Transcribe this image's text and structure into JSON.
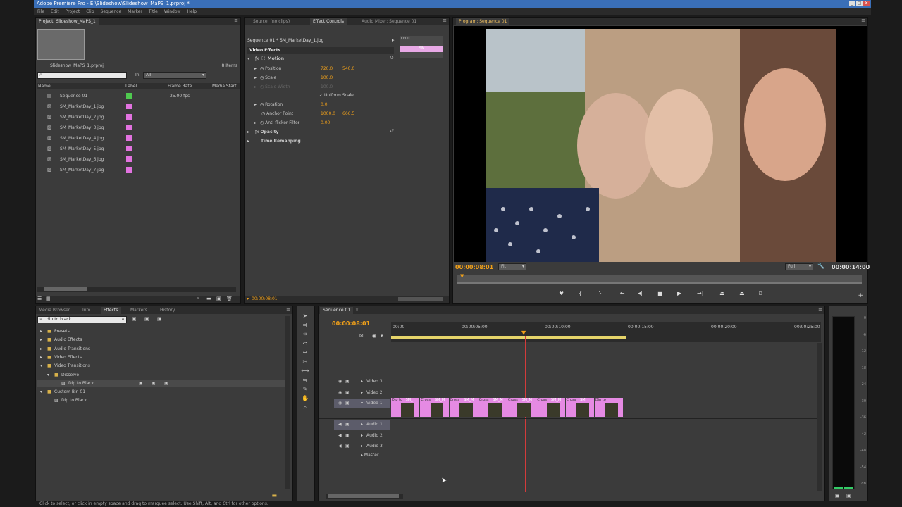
{
  "app": {
    "title": "Adobe Premiere Pro - E:\\Slideshow\\Slideshow_MaPS_1.prproj *",
    "menus": [
      "File",
      "Edit",
      "Project",
      "Clip",
      "Sequence",
      "Marker",
      "Title",
      "Window",
      "Help"
    ]
  },
  "project_panel": {
    "tab": "Project: Slideshow_MaPS_1",
    "project_file": "Slideshow_MaPS_1.prproj",
    "item_count": "8 Items",
    "in_label": "In:",
    "in_value": "All",
    "columns": [
      "Name",
      "Label",
      "Frame Rate",
      "Media Start"
    ],
    "items": [
      {
        "name": "Sequence 01",
        "frame_rate": "25.00 fps",
        "label_color": "#4fc94f"
      },
      {
        "name": "SM_MarketDay_1.jpg",
        "frame_rate": "",
        "label_color": "#e273e0"
      },
      {
        "name": "SM_MarketDay_2.jpg",
        "frame_rate": "",
        "label_color": "#e273e0"
      },
      {
        "name": "SM_MarketDay_3.jpg",
        "frame_rate": "",
        "label_color": "#e273e0"
      },
      {
        "name": "SM_MarketDay_4.jpg",
        "frame_rate": "",
        "label_color": "#e273e0"
      },
      {
        "name": "SM_MarketDay_5.jpg",
        "frame_rate": "",
        "label_color": "#e273e0"
      },
      {
        "name": "SM_MarketDay_6.jpg",
        "frame_rate": "",
        "label_color": "#e273e0"
      },
      {
        "name": "SM_MarketDay_7.jpg",
        "frame_rate": "",
        "label_color": "#e273e0"
      }
    ]
  },
  "effect_controls": {
    "tabs": [
      "Source: (no clips)",
      "Effect Controls",
      "Audio Mixer: Sequence 01"
    ],
    "clip_path": "Sequence 01 * SM_MarketDay_1.jpg",
    "time_start": "00:00",
    "clip_mini": "SM",
    "section": "Video Effects",
    "motion": "Motion",
    "position_label": "Position",
    "position_x": "720.0",
    "position_y": "540.0",
    "scale_label": "Scale",
    "scale_value": "100.0",
    "scale_width_label": "Scale Width",
    "scale_width_value": "100.0",
    "uniform_scale": "Uniform Scale",
    "rotation_label": "Rotation",
    "rotation_value": "0.0",
    "anchor_label": "Anchor Point",
    "anchor_x": "1000.0",
    "anchor_y": "666.5",
    "antiflicker_label": "Anti-flicker Filter",
    "antiflicker_value": "0.00",
    "opacity": "Opacity",
    "time_remapping": "Time Remapping",
    "footer_time": "00:00:08:01"
  },
  "program_monitor": {
    "tab": "Program: Sequence 01",
    "current_time": "00:00:08:01",
    "fit": "Fit",
    "quality": "Full",
    "duration": "00:00:14:00"
  },
  "effects_panel": {
    "tabs": [
      "Media Browser",
      "Info",
      "Effects",
      "Markers",
      "History"
    ],
    "search": "dip to black",
    "tree": [
      {
        "label": "Presets",
        "indent": 0,
        "expanded": false,
        "type": "folder"
      },
      {
        "label": "Audio Effects",
        "indent": 0,
        "expanded": false,
        "type": "folder"
      },
      {
        "label": "Audio Transitions",
        "indent": 0,
        "expanded": false,
        "type": "folder"
      },
      {
        "label": "Video Effects",
        "indent": 0,
        "expanded": false,
        "type": "folder"
      },
      {
        "label": "Video Transitions",
        "indent": 0,
        "expanded": true,
        "type": "folder"
      },
      {
        "label": "Dissolve",
        "indent": 1,
        "expanded": true,
        "type": "folder"
      },
      {
        "label": "Dip to Black",
        "indent": 2,
        "expanded": false,
        "type": "effect",
        "selected": true
      },
      {
        "label": "Custom Bin 01",
        "indent": 0,
        "expanded": true,
        "type": "bin"
      },
      {
        "label": "Dip to Black",
        "indent": 1,
        "expanded": false,
        "type": "effect"
      }
    ]
  },
  "timeline": {
    "tab": "Sequence 01",
    "current_time": "00:00:08:01",
    "ruler": [
      "00:00",
      "00:00:05:00",
      "00:00:10:00",
      "00:00:15:00",
      "00:00:20:00",
      "00:00:25:00"
    ],
    "video_tracks": [
      "Video 3",
      "Video 2",
      "Video 1"
    ],
    "audio_tracks": [
      "Audio 1",
      "Audio 2",
      "Audio 3"
    ],
    "master": "Master",
    "clips": [
      {
        "label": "Dip to",
        "second": "SM_"
      },
      {
        "label": "Cross",
        "second": "SM_M"
      },
      {
        "label": "Cross",
        "second": "SM_M"
      },
      {
        "label": "Cross",
        "second": "SM_M"
      },
      {
        "label": "Cross",
        "second": "SM_M"
      },
      {
        "label": "Cross",
        "second": "SM_M"
      },
      {
        "label": "Cross",
        "second": "SM"
      },
      {
        "label": "Dip to",
        "second": ""
      }
    ]
  },
  "audio_meter": {
    "ticks": [
      "0",
      "-6",
      "-12",
      "-18",
      "-24",
      "-30",
      "-36",
      "-42",
      "-48",
      "-54",
      "dB"
    ]
  },
  "status_bar": "Click to select, or click in empty space and drag to marquee select. Use Shift, Alt, and Ctrl for other options."
}
